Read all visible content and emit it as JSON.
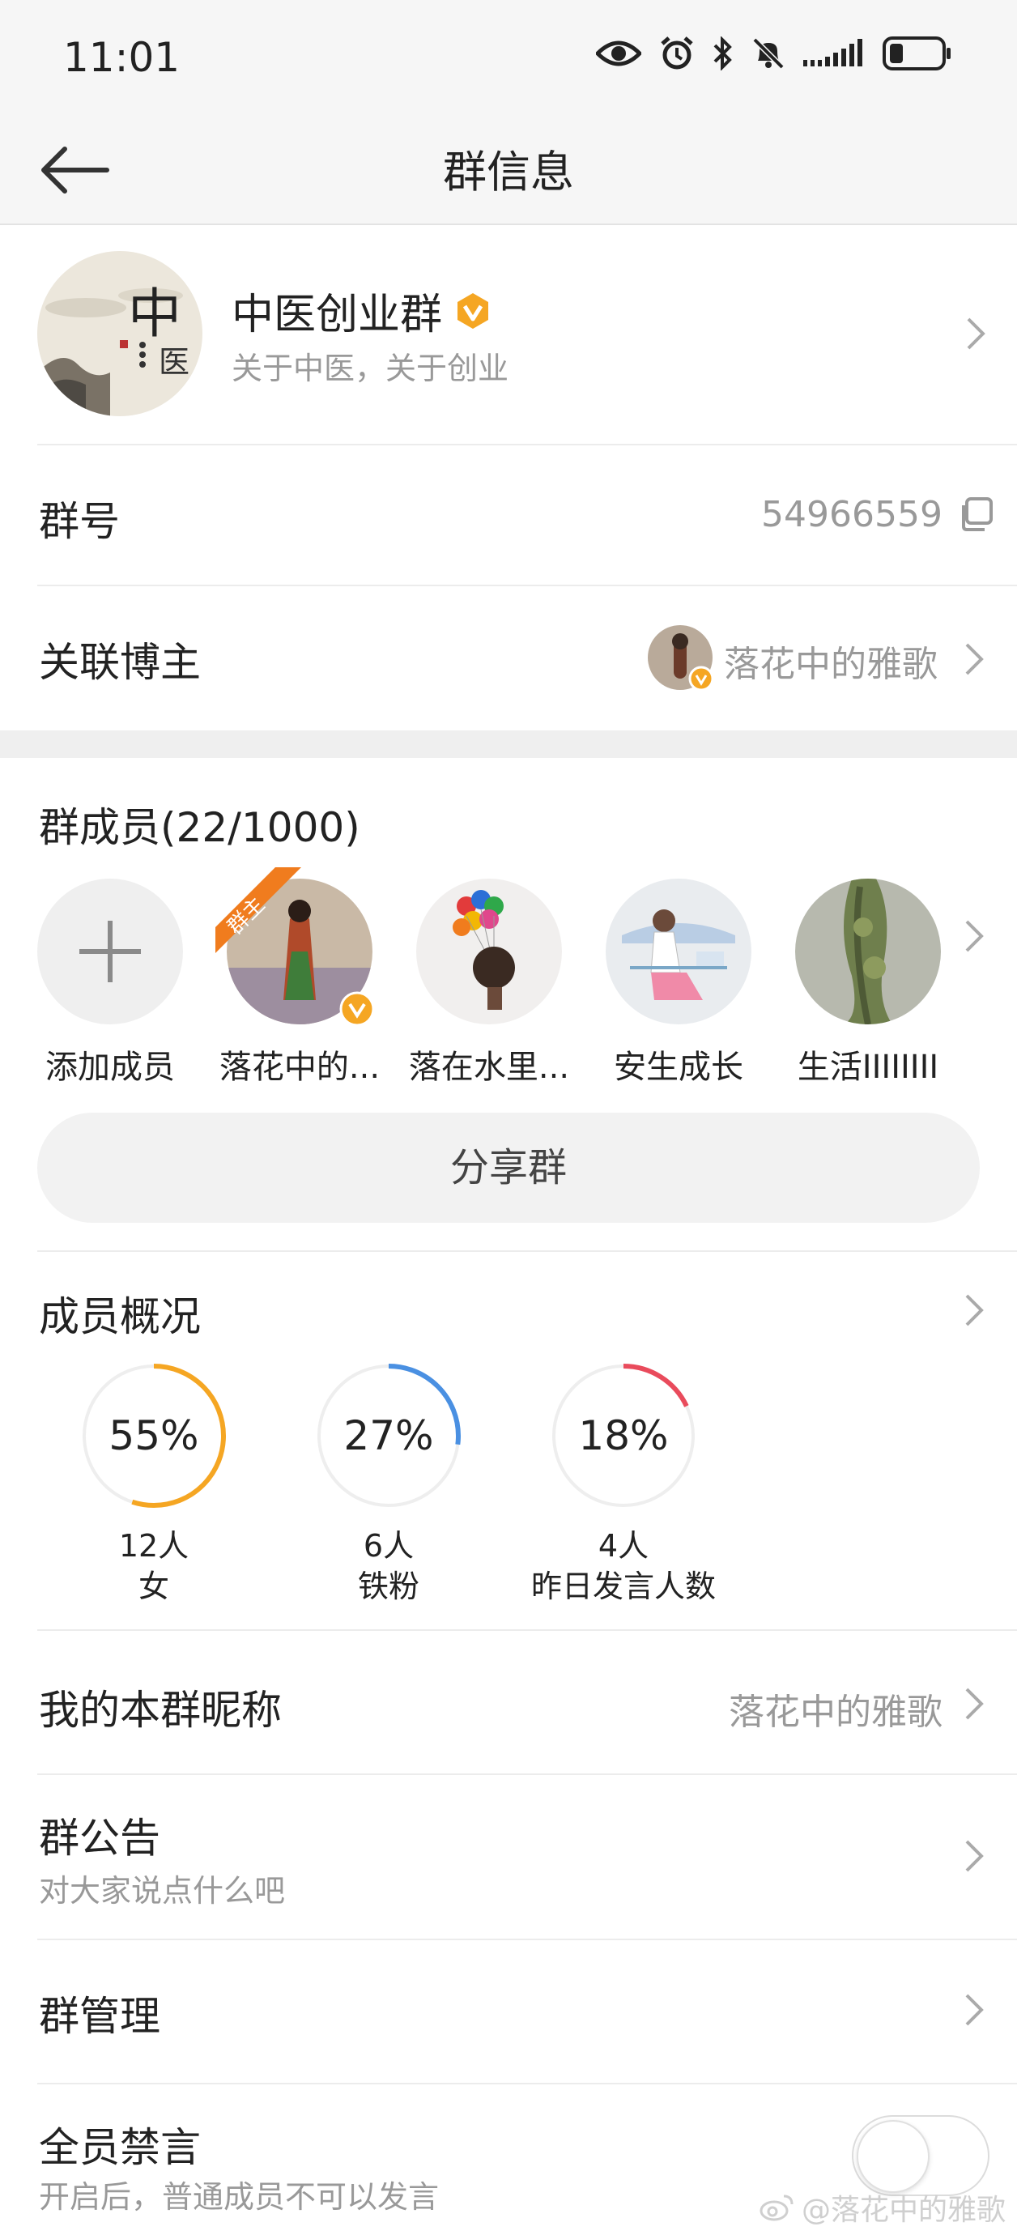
{
  "status_bar": {
    "time": "11:01",
    "icons": [
      "eye-icon",
      "alarm-icon",
      "bluetooth-icon",
      "mute-icon",
      "signal-icon",
      "battery-icon"
    ]
  },
  "header": {
    "title": "群信息",
    "back_icon": "arrow-left-icon"
  },
  "group": {
    "name": "中医创业群",
    "description": "关于中医，关于创业",
    "avatar_text": "中 医"
  },
  "group_number": {
    "label": "群号",
    "value": "54966559"
  },
  "linked_blogger": {
    "label": "关联博主",
    "name": "落花中的雅歌"
  },
  "members": {
    "title": "群成员(22/1000)",
    "items": [
      {
        "name": "添加成员",
        "type": "add"
      },
      {
        "name": "落花中的...",
        "badge": "群主"
      },
      {
        "name": "落在水里..."
      },
      {
        "name": "安生成长"
      },
      {
        "name": "生活IIIIIIII"
      }
    ]
  },
  "share_button": "分享群",
  "overview": {
    "title": "成员概况",
    "stats": [
      {
        "percent_text": "55%",
        "percent": 0.55,
        "count": "12人",
        "label": "女",
        "color": "#f5a623"
      },
      {
        "percent_text": "27%",
        "percent": 0.27,
        "count": "6人",
        "label": "铁粉",
        "color": "#4a90e2"
      },
      {
        "percent_text": "18%",
        "percent": 0.18,
        "count": "4人",
        "label": "昨日发言人数",
        "color": "#e94b5c"
      }
    ]
  },
  "nickname": {
    "label": "我的本群昵称",
    "value": "落花中的雅歌"
  },
  "announcement": {
    "label": "群公告",
    "sub": "对大家说点什么吧"
  },
  "management": {
    "label": "群管理"
  },
  "mute_all": {
    "label": "全员禁言",
    "sub": "开启后，普通成员不可以发言",
    "enabled": false
  },
  "watermark": "@落花中的雅歌",
  "colors": {
    "accent_orange": "#f5a623",
    "ring_track": "#eeeeee",
    "secondary_text": "#999999"
  }
}
